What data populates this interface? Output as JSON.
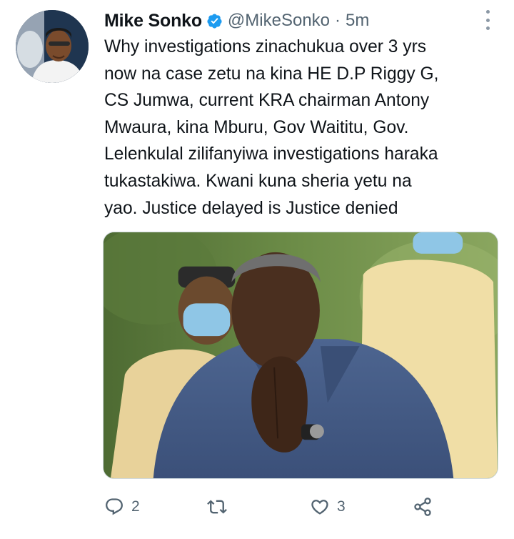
{
  "tweet": {
    "author_name": "Mike Sonko",
    "handle": "@MikeSonko",
    "separator": "·",
    "time": "5m",
    "text": "Why investigations zinachukua over 3 yrs\nnow na case zetu na kina HE D.P Riggy G,\nCS Jumwa, current KRA chairman Antony\nMwaura, kina Mburu, Gov Waititu, Gov.\nLelenkulal zilifanyiwa investigations haraka\ntukastakiwa. Kwani kuna sheria yetu na\nyao. Justice delayed is Justice denied"
  },
  "actions": {
    "reply_count": "2",
    "retweet_count": "",
    "like_count": "3"
  },
  "icons": {
    "verified": "verified-badge-icon",
    "more": "more-options-icon",
    "reply": "reply-icon",
    "retweet": "retweet-icon",
    "like": "like-icon",
    "share": "share-icon"
  },
  "colors": {
    "verified_blue": "#1d9bf0",
    "text_primary": "#0f1419",
    "text_secondary": "#536471"
  }
}
